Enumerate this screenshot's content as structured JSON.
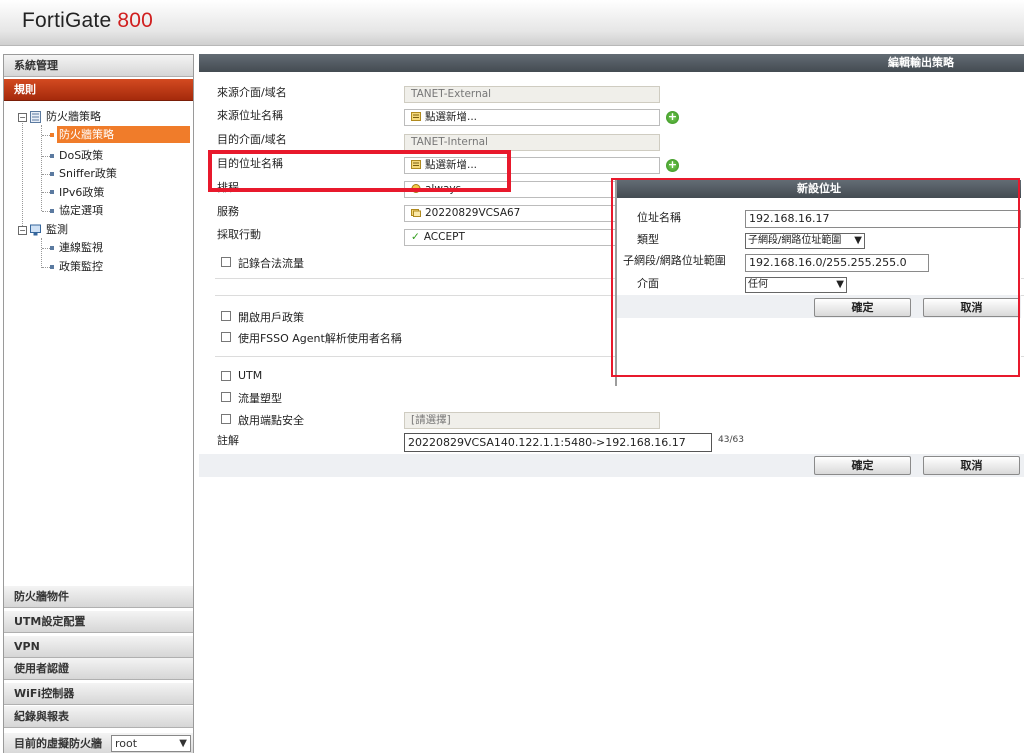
{
  "header": {
    "brand": "FortiGate",
    "model": "800"
  },
  "sidebar": {
    "sections_top": [
      "系統管理",
      "規則"
    ],
    "tree": {
      "firewall_policy_group": "防火牆策略",
      "firewall_policy": "防火牆策略",
      "dos_policy": "DoS政策",
      "sniffer_policy": "Sniffer政策",
      "ipv6_policy": "IPv6政策",
      "protocol_options": "協定選項",
      "monitor_group": "監測",
      "session_monitor": "連線監視",
      "policy_monitor": "政策監控"
    },
    "sections_bottom": [
      "防火牆物件",
      "UTM設定配置",
      "VPN",
      "使用者認證",
      "WiFi控制器",
      "紀錄與報表"
    ],
    "vdom_label": "目前的虛擬防火牆",
    "vdom_value": "root"
  },
  "panel": {
    "title": "編輯輸出策略",
    "src_intf_label": "來源介面/域名",
    "src_intf_value": "TANET-External",
    "src_addr_label": "來源位址名稱",
    "src_addr_value": "點選新增...",
    "dst_intf_label": "目的介面/域名",
    "dst_intf_value": "TANET-Internal",
    "dst_addr_label": "目的位址名稱",
    "dst_addr_value": "點選新增...",
    "schedule_label": "排程",
    "schedule_value": "always",
    "service_label": "服務",
    "service_value": "20220829VCSA67",
    "action_label": "採取行動",
    "action_value": "ACCEPT",
    "log_traffic_label": "記錄合法流量",
    "user_policy_label": "開啟用戶政策",
    "fsso_label": "使用FSSO Agent解析使用者名稱",
    "utm_label": "UTM",
    "traffic_shaping_label": "流量塑型",
    "endpoint_label": "啟用端點安全",
    "endpoint_value": "[請選擇]",
    "comments_label": "註解",
    "comments_value": "20220829VCSA140.122.1.1:5480->192.168.16.17",
    "comments_counter": "43/63",
    "ok_label": "確定",
    "cancel_label": "取消"
  },
  "dialog": {
    "title": "新設位址",
    "name_label": "位址名稱",
    "name_value": "192.168.16.17",
    "type_label": "類型",
    "type_value": "子網段/網路位址範圍",
    "subnet_label": "子網段/網路位址範圍",
    "subnet_value": "192.168.16.0/255.255.255.0",
    "intf_label": "介面",
    "intf_value": "任何",
    "ok_label": "確定",
    "cancel_label": "取消"
  },
  "colors": {
    "accent_red": "#d01f1f",
    "highlight": "#e8192c",
    "selected_tree": "#f07c2a",
    "title_bar": "#4e565d"
  }
}
